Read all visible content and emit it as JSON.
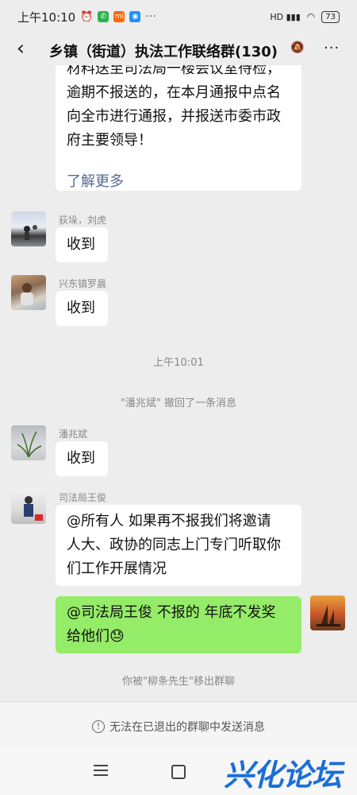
{
  "status_bar": {
    "time": "上午10:10",
    "right_text": "HD",
    "battery": "73"
  },
  "nav": {
    "title": "乡镇（街道）执法工作联络群(130)"
  },
  "messages": {
    "partial": {
      "line1": "材料送至司法局一楼会议室待检，",
      "line2": "逾期不报送的，在本月通报中点名",
      "line3": "向全市进行通报，并报送市委市政",
      "line4": "府主要领导！",
      "link": "了解更多"
    },
    "m1": {
      "sender": "荻垛，刘虎",
      "text": "收到"
    },
    "m2": {
      "sender": "兴东镇罗晨",
      "text": "收到"
    },
    "time_divider": "上午10:01",
    "recall": "\"潘兆斌\" 撤回了一条消息",
    "m3": {
      "sender": "潘兆斌",
      "text": "收到"
    },
    "m4": {
      "sender": "司法局王俊",
      "line1": "@所有人  如果再不报我们将邀请",
      "line2": "人大、政协的同志上门专门听取你",
      "line3": "们工作开展情况"
    },
    "m5": {
      "line1": "@司法局王俊  不报的 年底不发奖",
      "line2": "给他们",
      "emoji": "😓"
    },
    "removed_tip": "你被\"柳条先生\"移出群聊"
  },
  "bottom": {
    "notice": "无法在已退出的群聊中发送消息"
  },
  "watermark": "兴化论坛"
}
